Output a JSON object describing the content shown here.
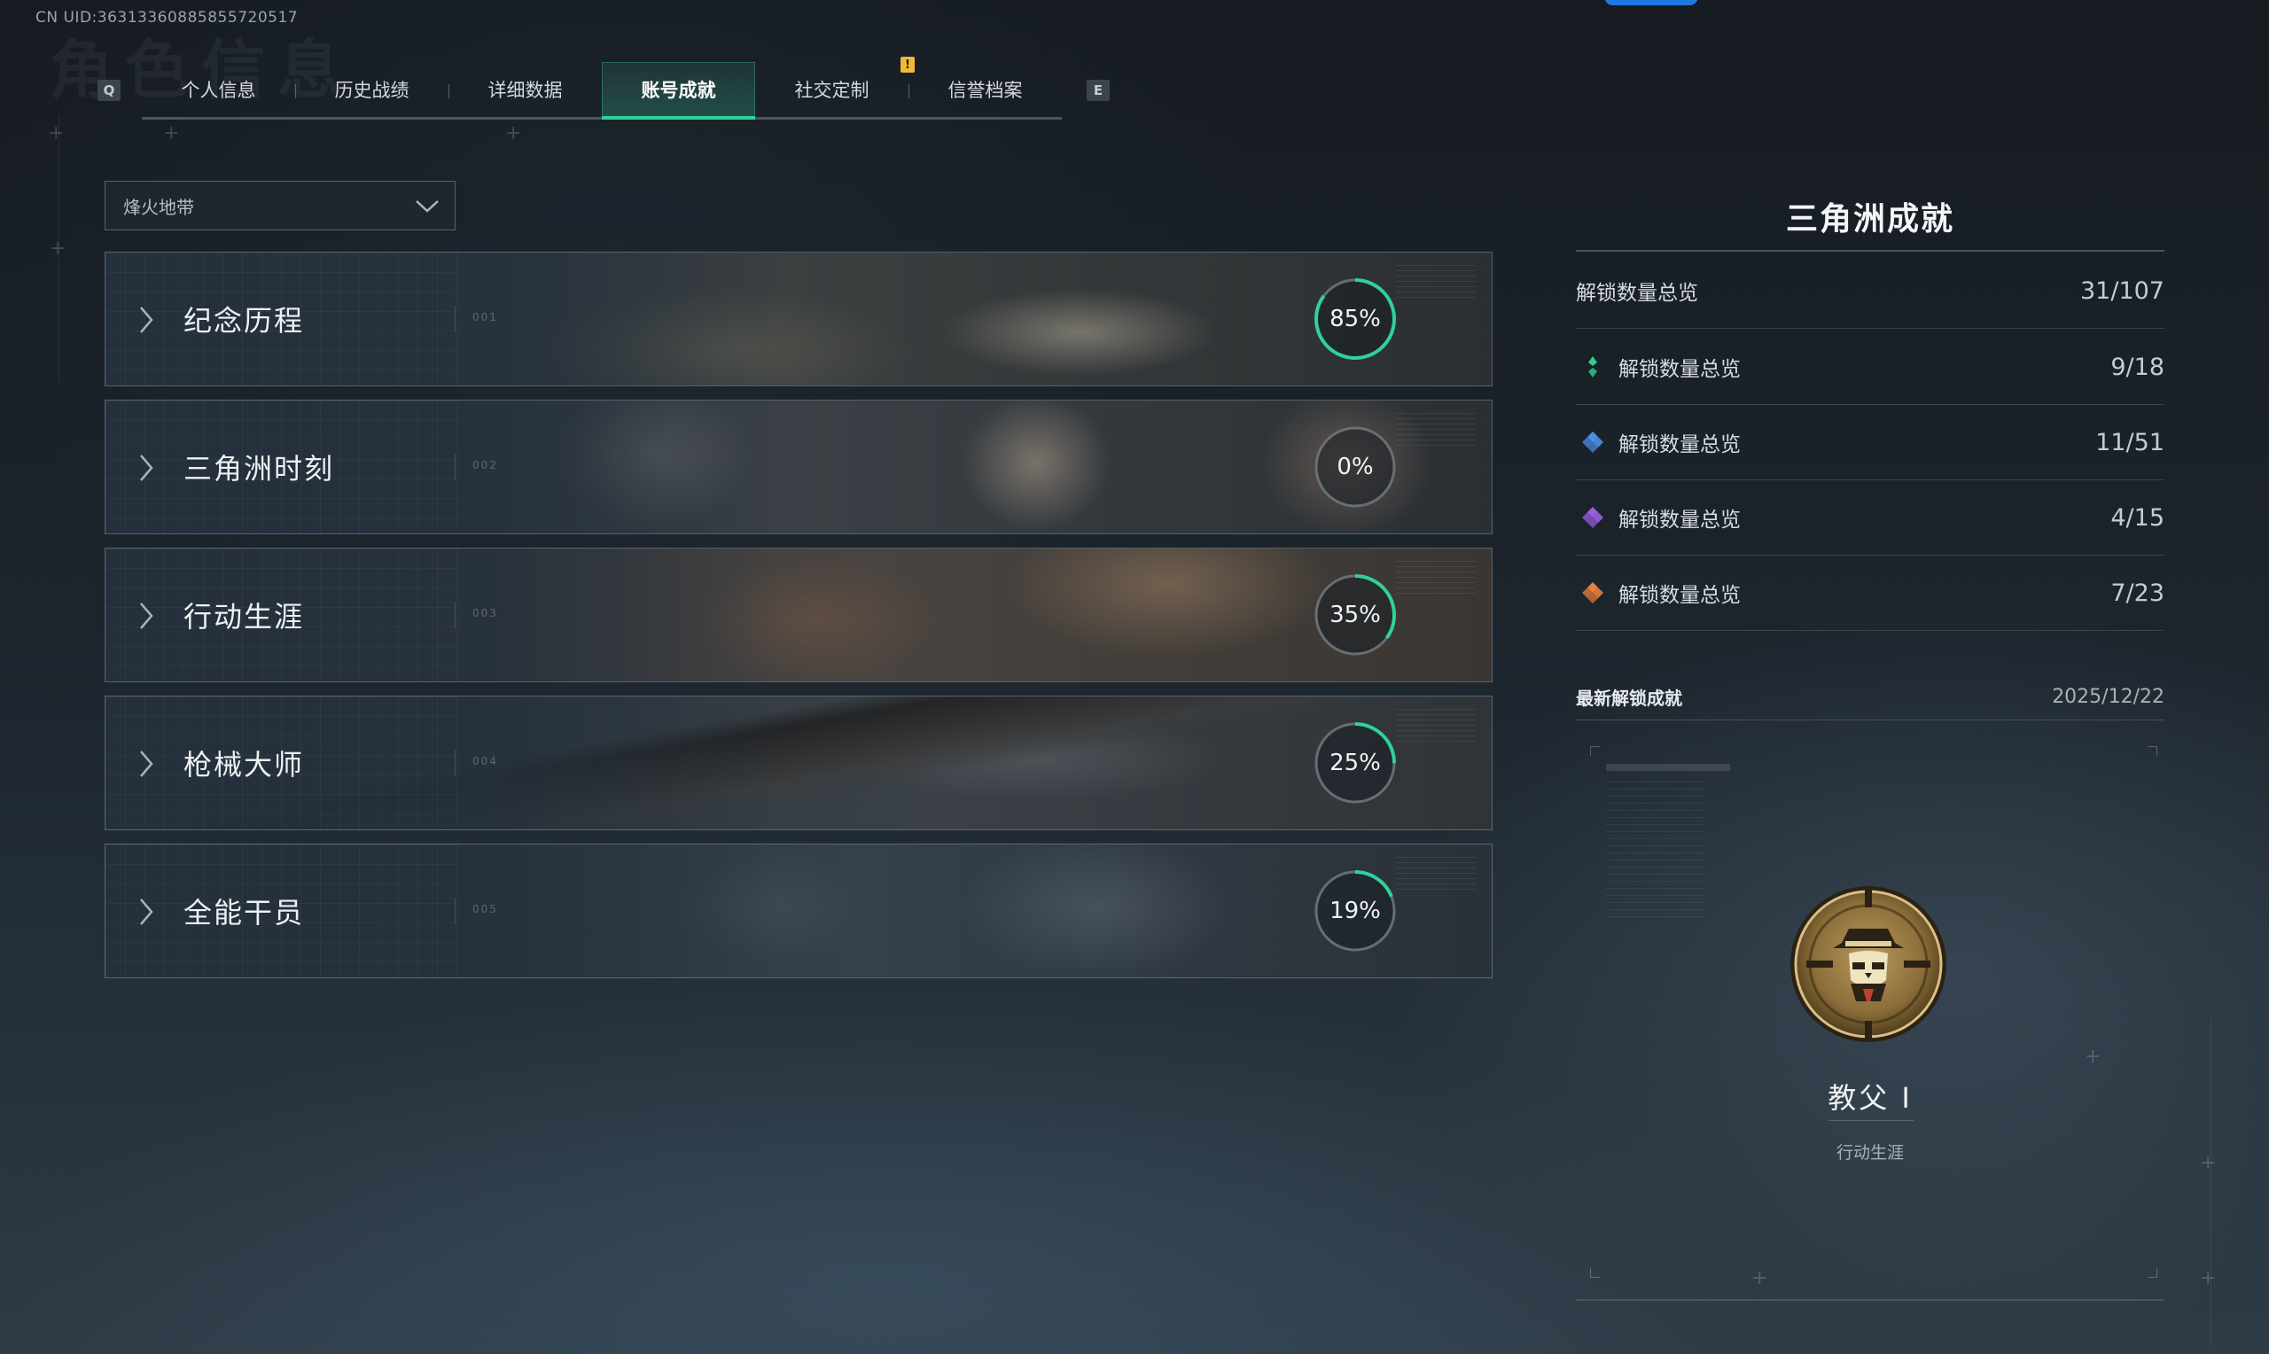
{
  "uid": "CN UID:3631336088585572051​7",
  "bg_title": "角色信息",
  "tabs": {
    "prev_key": "Q",
    "next_key": "E",
    "notice": "!",
    "items": [
      {
        "label": "个人信息"
      },
      {
        "label": "历史战绩"
      },
      {
        "label": "详细数据"
      },
      {
        "label": "账号成就"
      },
      {
        "label": "社交定制"
      },
      {
        "label": "信誉档案"
      }
    ],
    "active_index": 3
  },
  "mode_select": {
    "value": "烽火地带"
  },
  "categories": [
    {
      "name": "纪念历程",
      "code": "001",
      "percent_label": "85%",
      "progress": 0.85
    },
    {
      "name": "三角洲时刻",
      "code": "002",
      "percent_label": "0%",
      "progress": 0.0
    },
    {
      "name": "行动生涯",
      "code": "003",
      "percent_label": "35%",
      "progress": 0.35
    },
    {
      "name": "枪械大师",
      "code": "004",
      "percent_label": "25%",
      "progress": 0.25
    },
    {
      "name": "全能干员",
      "code": "005",
      "percent_label": "19%",
      "progress": 0.19
    }
  ],
  "summary": {
    "title": "三角洲成就",
    "total": {
      "label": "解锁数量总览",
      "value": "31/107"
    },
    "rows": [
      {
        "icon": "green-gem-icon",
        "color": "#2fcf8c",
        "label": "解锁数量总览",
        "value": "9/18"
      },
      {
        "icon": "blue-gem-icon",
        "color": "#4b8fe8",
        "label": "解锁数量总览",
        "value": "11/51"
      },
      {
        "icon": "purple-gem-icon",
        "color": "#9a5fe0",
        "label": "解锁数量总览",
        "value": "4/15"
      },
      {
        "icon": "orange-gem-icon",
        "color": "#e8823a",
        "label": "解锁数量总览",
        "value": "7/23"
      }
    ]
  },
  "latest": {
    "heading": "最新解锁成就",
    "date": "2025/12/22",
    "badge_name": "教父 Ⅰ",
    "badge_category": "行动生涯",
    "badge_icon": "godfather-skull-badge-icon"
  },
  "colors": {
    "accent": "#2fd29a",
    "ring_track": "#6d747a"
  }
}
